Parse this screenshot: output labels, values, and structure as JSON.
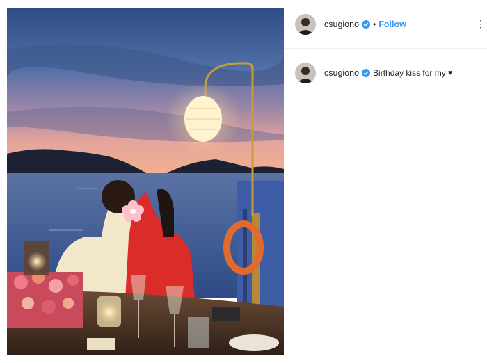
{
  "post": {
    "username": "csugiono",
    "follow_label": "Follow",
    "separator": "•",
    "more_icon": "⋮",
    "caption_text": "Birthday kiss for my",
    "caption_emoji": "♥"
  },
  "colors": {
    "link_blue": "#3897f0",
    "verified_blue": "#3897f0",
    "text": "#262626",
    "divider": "#efefef"
  }
}
